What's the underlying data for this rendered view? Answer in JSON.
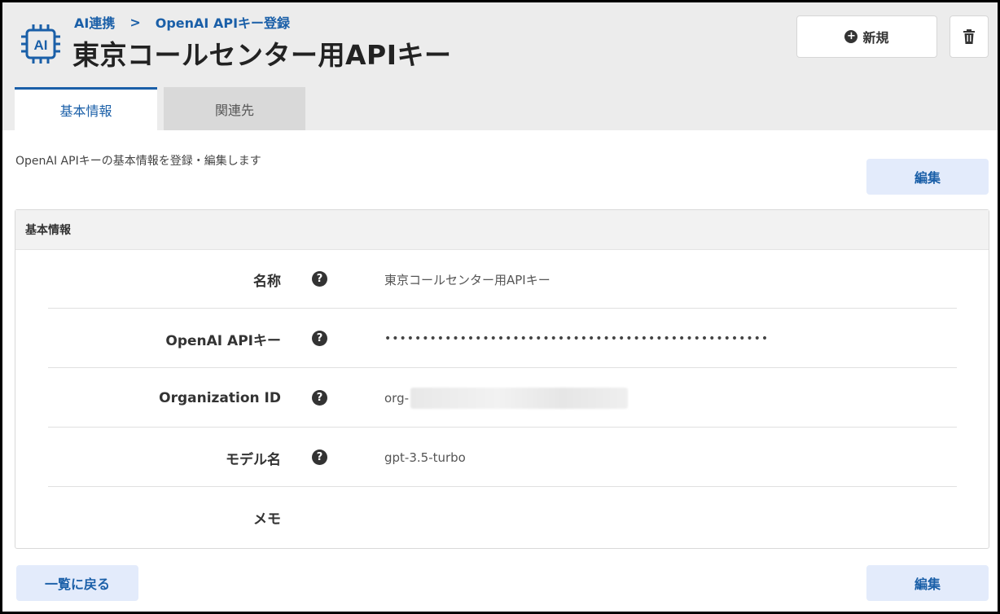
{
  "header": {
    "breadcrumb": [
      "AI連携",
      "OpenAI APIキー登録"
    ],
    "breadcrumb_separator": ">",
    "title": "東京コールセンター用APIキー",
    "app_icon": "ai-chip-icon",
    "app_icon_text": "AI",
    "new_button_label": "新規",
    "new_button_icon": "plus-circle-icon",
    "delete_button_icon": "trash-icon"
  },
  "tabs": [
    {
      "label": "基本情報",
      "active": true
    },
    {
      "label": "関連先",
      "active": false
    }
  ],
  "description": "OpenAI APIキーの基本情報を登録・編集します",
  "edit_label": "編集",
  "panel": {
    "title": "基本情報",
    "rows": [
      {
        "label": "名称",
        "help": true,
        "value": "東京コールセンター用APIキー"
      },
      {
        "label": "OpenAI APIキー",
        "help": true,
        "value": "•••••••••••••••••••••••••••••••••••••••••••••••••••"
      },
      {
        "label": "Organization ID",
        "help": true,
        "value": "org-"
      },
      {
        "label": "モデル名",
        "help": true,
        "value": "gpt-3.5-turbo"
      },
      {
        "label": "メモ",
        "help": false,
        "value": ""
      }
    ]
  },
  "footer": {
    "back_label": "一覧に戻る",
    "edit_label": "編集"
  },
  "colors": {
    "accent": "#1a5fa8",
    "header_bg": "#ececec",
    "button_soft_bg": "#e3ebfb"
  }
}
